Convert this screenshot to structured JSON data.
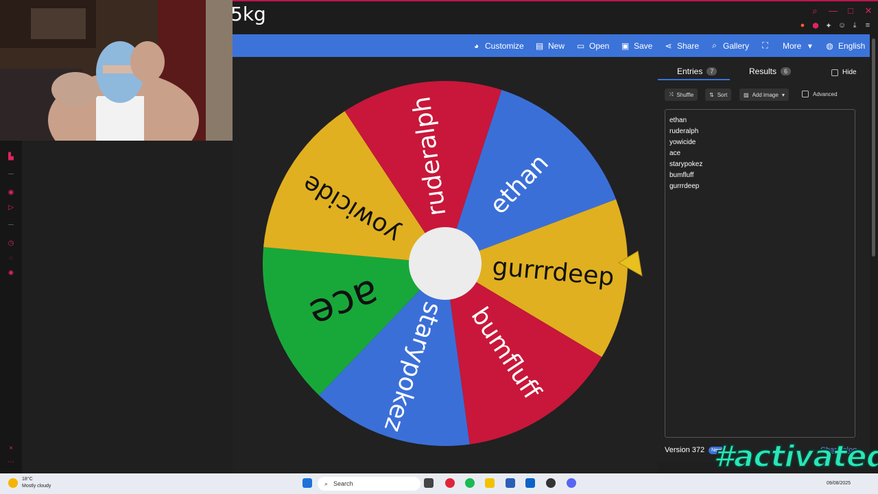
{
  "browser": {
    "page_title_fragment": "5kg"
  },
  "toolbar": {
    "customize": "Customize",
    "new": "New",
    "open": "Open",
    "save": "Save",
    "share": "Share",
    "gallery": "Gallery",
    "more": "More",
    "language": "English"
  },
  "wheel": {
    "segments": [
      {
        "label": "ethan",
        "color": "#3b6fd8"
      },
      {
        "label": "gurrrdeep",
        "color": "#e0b020"
      },
      {
        "label": "bumfluff",
        "color": "#c8173a"
      },
      {
        "label": "starypokez",
        "color": "#3b6fd8"
      },
      {
        "label": "ace",
        "color": "#18a83a"
      },
      {
        "label": "yowicide",
        "color": "#e0b020"
      },
      {
        "label": "ruderalph",
        "color": "#c8173a"
      }
    ],
    "pointer_color": "#e8c020"
  },
  "panel": {
    "entries_tab": "Entries",
    "entries_count": "7",
    "results_tab": "Results",
    "results_count": "6",
    "hide_label": "Hide",
    "shuffle": "Shuffle",
    "sort": "Sort",
    "add_image": "Add image",
    "advanced": "Advanced",
    "entries": [
      "ethan",
      "ruderalph",
      "yowicide",
      "ace",
      "starypokez",
      "bumfluff",
      "gurrrdeep"
    ],
    "version": "Version 372",
    "new_badge": "New!",
    "changelog": "Changelog"
  },
  "taskbar": {
    "temperature": "18°C",
    "weather": "Mostly cloudy",
    "search": "Search",
    "date": "09/08/2025"
  },
  "overlay": {
    "tag": "#activated"
  }
}
